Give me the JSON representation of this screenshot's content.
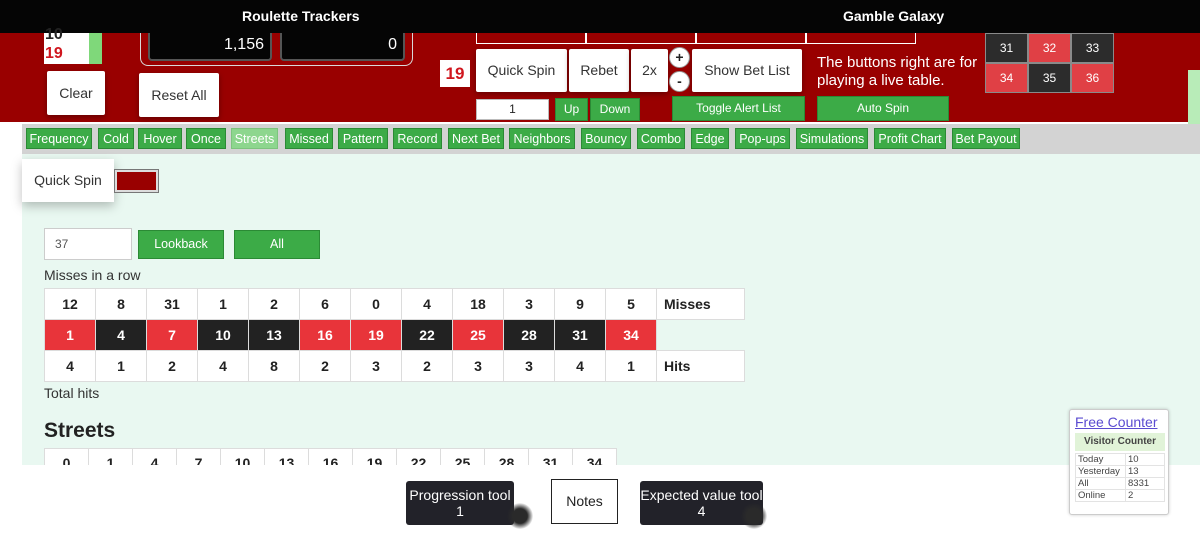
{
  "topbar": {
    "left_title": "Roulette Trackers",
    "right_title": "Gamble Galaxy"
  },
  "header": {
    "recent_spins": [
      "10",
      "19"
    ],
    "clear_label": "Clear",
    "reset_all_label": "Reset All",
    "balance": "1,156",
    "bet_amount": "0",
    "last_number": "19",
    "quick_spin_label": "Quick Spin",
    "rebet_label": "Rebet",
    "double_label": "2x",
    "plus_label": "+",
    "minus_label": "-",
    "show_bet_list_label": "Show Bet List",
    "spin_count_value": "1",
    "up_label": "Up",
    "down_label": "Down",
    "toggle_alert_label": "Toggle Alert List",
    "auto_spin_label": "Auto Spin",
    "live_table_text": "The buttons right are for playing a live table."
  },
  "wheel_numbers": [
    {
      "n": "31",
      "color": "black"
    },
    {
      "n": "32",
      "color": "red"
    },
    {
      "n": "33",
      "color": "black"
    },
    {
      "n": "34",
      "color": "red"
    },
    {
      "n": "35",
      "color": "black"
    },
    {
      "n": "36",
      "color": "red"
    }
  ],
  "tabs": [
    {
      "label": "Frequency",
      "active": false
    },
    {
      "label": "Cold",
      "active": false
    },
    {
      "label": "Hover",
      "active": false
    },
    {
      "label": "Once",
      "active": false
    },
    {
      "label": "Streets",
      "active": true
    },
    {
      "label": "Missed",
      "active": false
    },
    {
      "label": "Pattern",
      "active": false
    },
    {
      "label": "Record",
      "active": false
    },
    {
      "label": "Next Bet",
      "active": false
    },
    {
      "label": "Neighbors",
      "active": false
    },
    {
      "label": "Bouncy",
      "active": false
    },
    {
      "label": "Combo",
      "active": false
    },
    {
      "label": "Edge",
      "active": false
    },
    {
      "label": "Pop-ups",
      "active": false
    },
    {
      "label": "Simulations",
      "active": false
    },
    {
      "label": "Profit Chart",
      "active": false
    },
    {
      "label": "Bet Payout",
      "active": false
    }
  ],
  "content": {
    "quick_spin_label": "Quick Spin",
    "lookback_value": "37",
    "lookback_label": "Lookback",
    "all_label": "All",
    "misses_in_row_label": "Misses in a row",
    "misses": [
      "12",
      "8",
      "31",
      "1",
      "2",
      "6",
      "0",
      "4",
      "18",
      "3",
      "9",
      "5"
    ],
    "misses_label": "Misses",
    "street_numbers": [
      {
        "n": "1",
        "color": "red"
      },
      {
        "n": "4",
        "color": "black"
      },
      {
        "n": "7",
        "color": "red"
      },
      {
        "n": "10",
        "color": "black"
      },
      {
        "n": "13",
        "color": "black"
      },
      {
        "n": "16",
        "color": "red"
      },
      {
        "n": "19",
        "color": "red"
      },
      {
        "n": "22",
        "color": "black"
      },
      {
        "n": "25",
        "color": "red"
      },
      {
        "n": "28",
        "color": "black"
      },
      {
        "n": "31",
        "color": "black"
      },
      {
        "n": "34",
        "color": "red"
      }
    ],
    "hits": [
      "4",
      "1",
      "2",
      "4",
      "8",
      "2",
      "3",
      "2",
      "3",
      "3",
      "4",
      "1"
    ],
    "hits_label": "Hits",
    "total_hits_label": "Total hits",
    "streets_title": "Streets",
    "streets_header": [
      "0",
      "1",
      "4",
      "7",
      "10",
      "13",
      "16",
      "19",
      "22",
      "25",
      "28",
      "31",
      "34"
    ]
  },
  "floating": {
    "progression_label": "Progression tool 1",
    "notes_label": "Notes",
    "expected_value_label": "Expected value tool 4"
  },
  "counter": {
    "link_label": "Free Counter",
    "heading": "Visitor Counter",
    "rows": [
      {
        "label": "Today",
        "value": "10"
      },
      {
        "label": "Yesterday",
        "value": "13"
      },
      {
        "label": "All",
        "value": "8331"
      },
      {
        "label": "Online",
        "value": "2"
      }
    ]
  },
  "colors": {
    "header_red": "#990000",
    "tab_green": "#3cab47",
    "roulette_red": "#e8343a",
    "roulette_black": "#222222",
    "mint": "#e9f8f1"
  }
}
